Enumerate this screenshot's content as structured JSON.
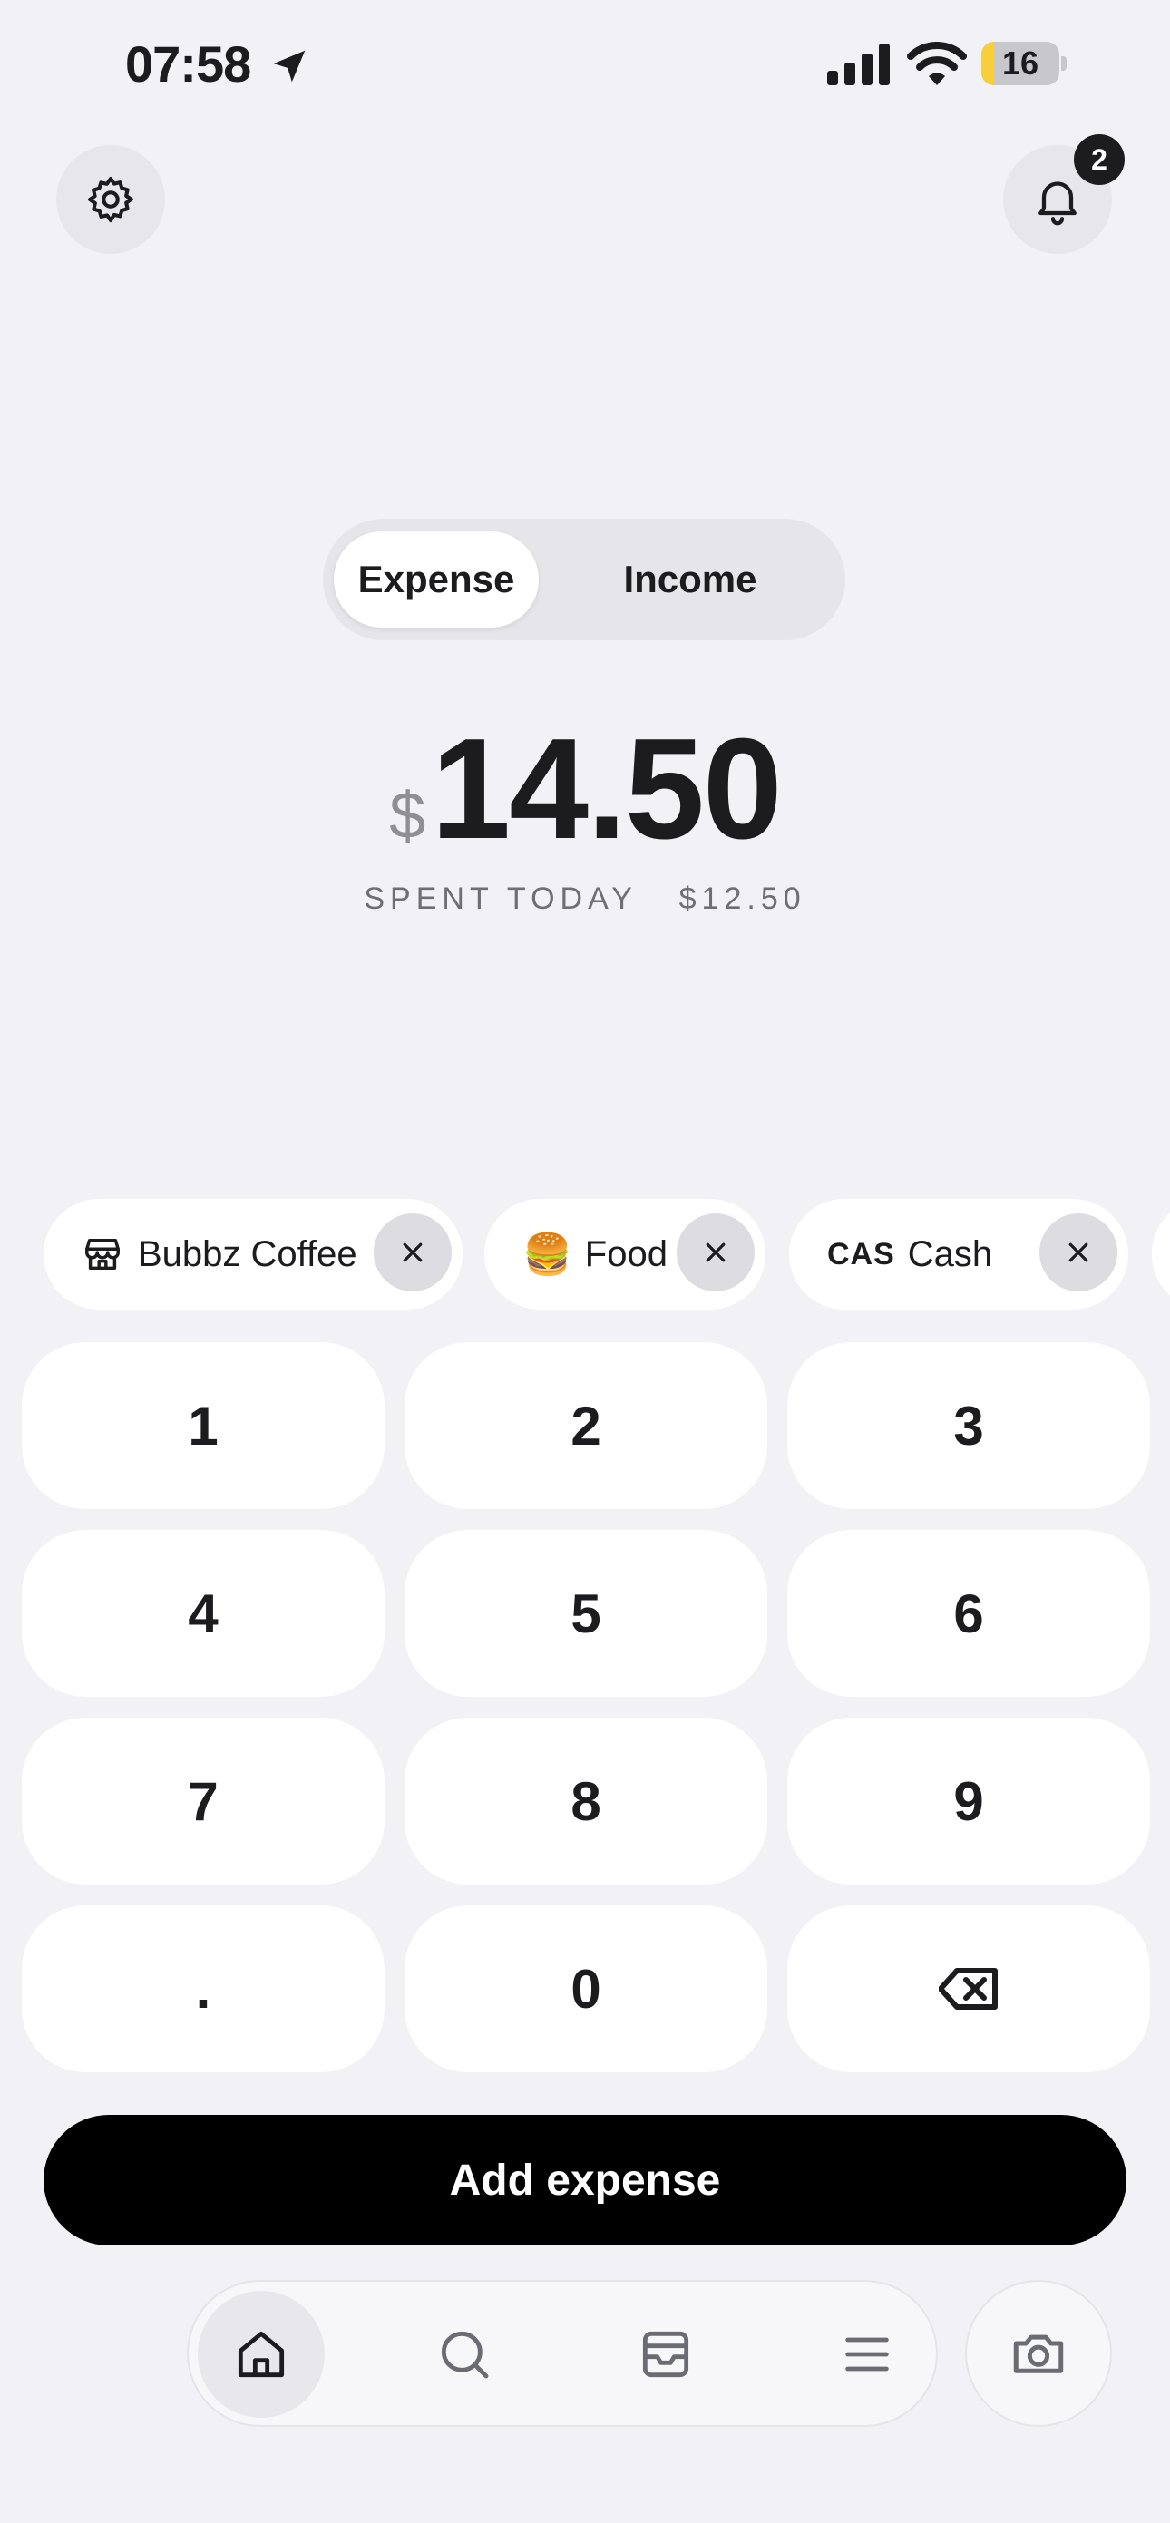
{
  "status_bar": {
    "time": "07:58",
    "battery": "16",
    "battery_level_percent": 16
  },
  "header": {
    "settings_icon": "gear-icon",
    "notifications_icon": "bell-icon",
    "notification_count": "2"
  },
  "mode_toggle": {
    "options": [
      "Expense",
      "Income"
    ],
    "selected": "Expense"
  },
  "amount": {
    "currency": "$",
    "value": "14.50",
    "spent_today": "SPENT TODAY   $12.50"
  },
  "chips": [
    {
      "icon": "store-icon",
      "label": "Bubbz Coffee"
    },
    {
      "icon": "🍔",
      "label": "Food"
    },
    {
      "icon": "CAS",
      "label": "Cash"
    },
    {
      "icon": "calendar-icon",
      "label": ""
    }
  ],
  "keypad": [
    "1",
    "2",
    "3",
    "4",
    "5",
    "6",
    "7",
    "8",
    "9",
    ".",
    "0",
    "⌫"
  ],
  "primary_action": {
    "label": "Add expense"
  },
  "tab_bar": {
    "items": [
      "home-icon",
      "search-icon",
      "inbox-icon",
      "menu-icon"
    ],
    "active": "home-icon",
    "camera": "camera-icon"
  },
  "colors": {
    "background": "#f1f1f6",
    "primary": "#000000",
    "battery_fill": "#f7cf3b"
  }
}
